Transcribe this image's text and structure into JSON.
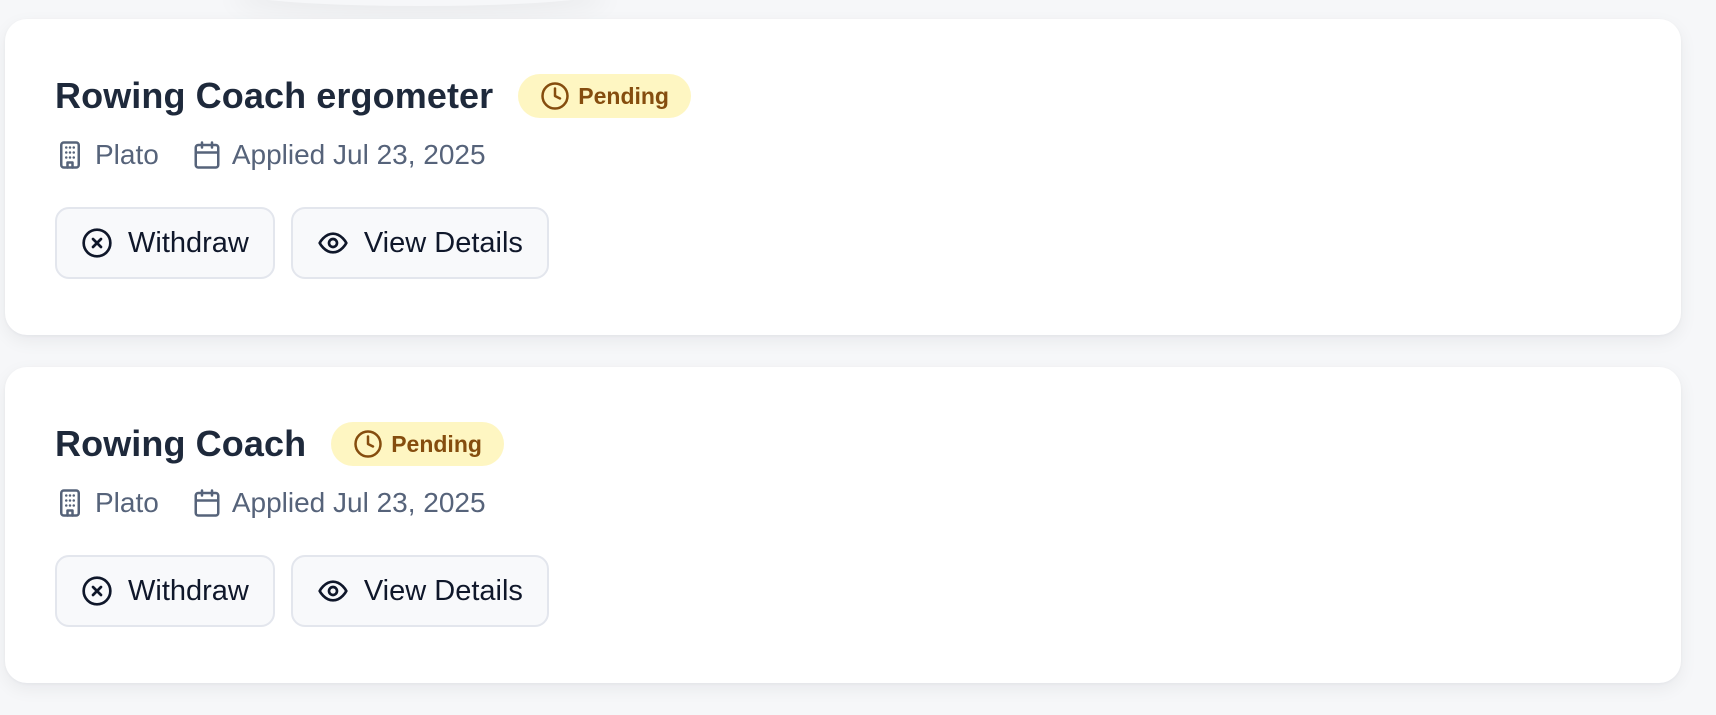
{
  "applications": [
    {
      "title": "Rowing Coach ergometer",
      "status": "Pending",
      "company": "Plato",
      "applied": "Applied Jul 23, 2025",
      "withdraw_label": "Withdraw",
      "details_label": "View Details"
    },
    {
      "title": "Rowing Coach",
      "status": "Pending",
      "company": "Plato",
      "applied": "Applied Jul 23, 2025",
      "withdraw_label": "Withdraw",
      "details_label": "View Details"
    }
  ],
  "icons": {
    "status": "clock-icon",
    "company": "building-icon",
    "date": "calendar-icon",
    "withdraw": "x-circle-icon",
    "details": "eye-icon"
  },
  "colors": {
    "badge_bg": "#fef6c2",
    "badge_text": "#854d0e",
    "title": "#1e293b",
    "meta": "#56637a",
    "card_bg": "#ffffff",
    "page_bg": "#f6f7f9"
  }
}
